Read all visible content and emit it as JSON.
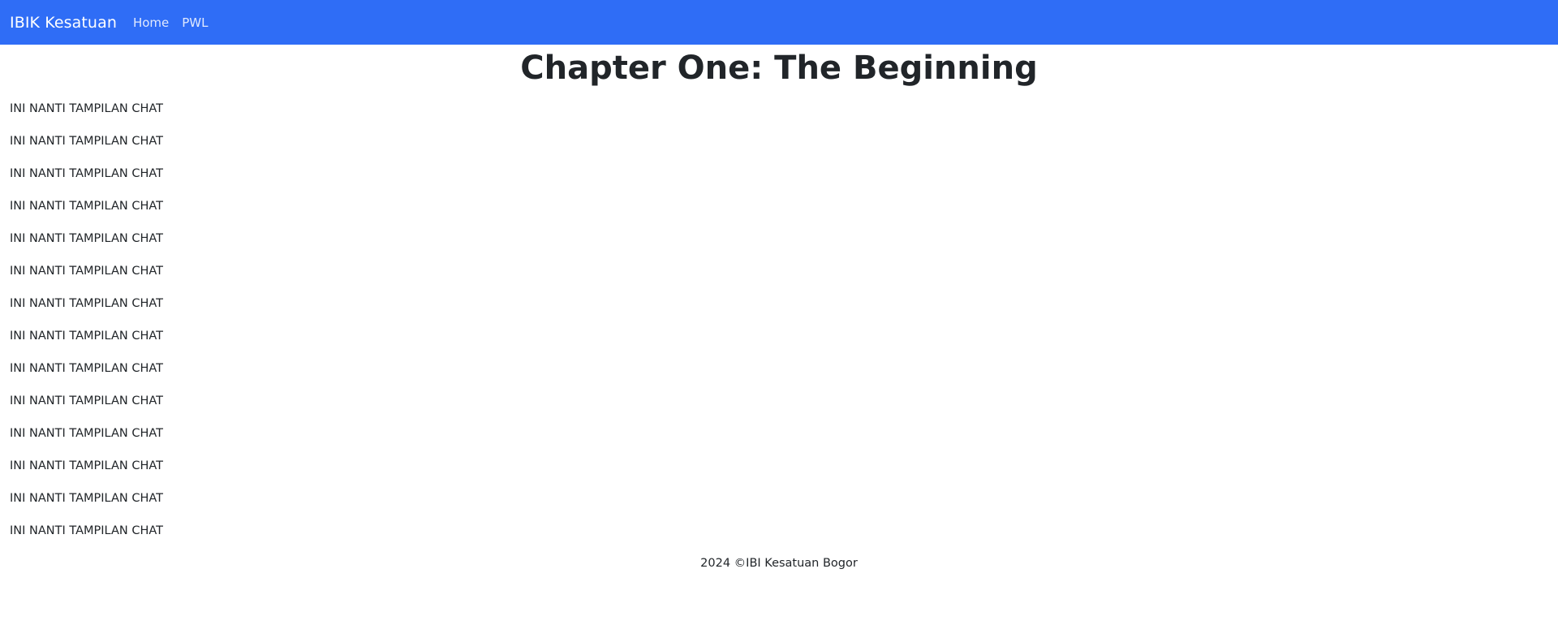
{
  "navbar": {
    "brand": "IBIK Kesatuan",
    "links": [
      "Home",
      "PWL"
    ],
    "color": "#2f6df6"
  },
  "main": {
    "title": "Chapter One: The Beginning",
    "chat_lines": [
      "INI NANTI TAMPILAN CHAT",
      "INI NANTI TAMPILAN CHAT",
      "INI NANTI TAMPILAN CHAT",
      "INI NANTI TAMPILAN CHAT",
      "INI NANTI TAMPILAN CHAT",
      "INI NANTI TAMPILAN CHAT",
      "INI NANTI TAMPILAN CHAT",
      "INI NANTI TAMPILAN CHAT",
      "INI NANTI TAMPILAN CHAT",
      "INI NANTI TAMPILAN CHAT",
      "INI NANTI TAMPILAN CHAT",
      "INI NANTI TAMPILAN CHAT",
      "INI NANTI TAMPILAN CHAT",
      "INI NANTI TAMPILAN CHAT"
    ]
  },
  "footer": {
    "text": "2024 ©IBI Kesatuan Bogor"
  }
}
